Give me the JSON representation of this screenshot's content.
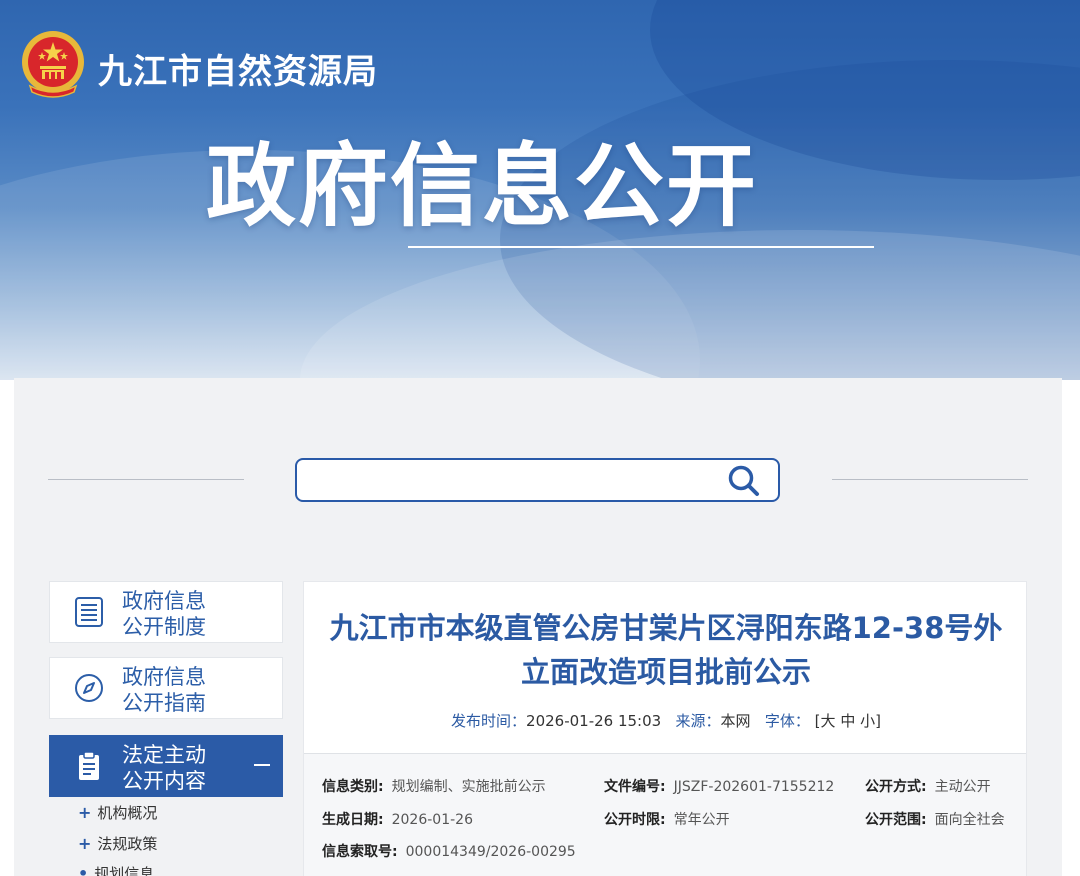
{
  "header": {
    "site_name": "九江市自然资源局",
    "hero_title": "政府信息公开",
    "emblem_icon": "national-emblem-icon"
  },
  "search": {
    "placeholder": "",
    "icon": "search-icon"
  },
  "sidebar": {
    "items": [
      {
        "line1": "政府信息",
        "line2": "公开制度",
        "icon": "document-list-icon",
        "active": false
      },
      {
        "line1": "政府信息",
        "line2": "公开指南",
        "icon": "compass-icon",
        "active": false
      },
      {
        "line1": "法定主动",
        "line2": "公开内容",
        "icon": "clipboard-icon",
        "active": true,
        "expanded_icon": "minus-icon"
      }
    ],
    "sub_items": [
      {
        "marker": "+",
        "label": "机构概况"
      },
      {
        "marker": "+",
        "label": "法规政策"
      },
      {
        "marker": "•",
        "label": "规划信息"
      }
    ]
  },
  "article": {
    "title_line1": "九江市市本级直管公房甘棠片区浔阳东路12-38号外",
    "title_line2": "立面改造项目批前公示",
    "publish_label": "发布时间：",
    "publish_time": "2026-01-26 15:03",
    "source_label": "来源：",
    "source": "本网",
    "font_label": "字体：",
    "font_open": "[",
    "font_large": "大",
    "font_medium": "中",
    "font_small": "小",
    "font_close": "]",
    "info": {
      "category_label": "信息类别:",
      "category": "规划编制、实施批前公示",
      "doc_no_label": "文件编号:",
      "doc_no": "JJSZF-202601-7155212",
      "disclosure_method_label": "公开方式:",
      "disclosure_method": "主动公开",
      "created_label": "生成日期:",
      "created": "2026-01-26",
      "disclosure_period_label": "公开时限:",
      "disclosure_period": "常年公开",
      "disclosure_scope_label": "公开范围:",
      "disclosure_scope": "面向全社会",
      "index_label": "信息索取号:",
      "index": "000014349/2026-00295"
    }
  },
  "colors": {
    "brand_blue": "#2b5ba7",
    "title_blue": "#2b5aa3",
    "panel_bg": "#f1f2f4"
  }
}
